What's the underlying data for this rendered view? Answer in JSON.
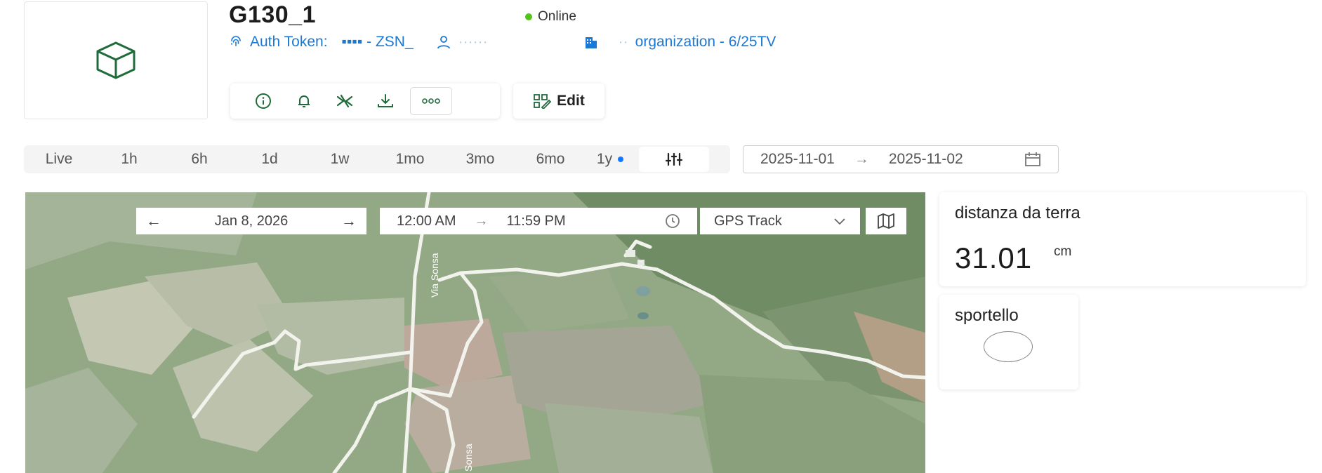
{
  "device": {
    "name": "G130_1",
    "status": "Online",
    "auth_token_label": "Auth Token:",
    "auth_token_value": "▪▪▪▪ - ZSN_",
    "user_value": "······",
    "org_prefix": "··",
    "org_value": "organization - 6/25TV",
    "thumbnail_icon": "cube-icon"
  },
  "colors": {
    "accent": "#1677ff",
    "online": "#52c41a",
    "brand_green": "#1f6b3a",
    "link": "#1b78d4"
  },
  "toolbar": {
    "icons": [
      "info-icon",
      "bell-icon",
      "settings-icon",
      "download-icon",
      "more-icon"
    ],
    "edit_label": "Edit"
  },
  "time_range": {
    "tabs": [
      "Live",
      "1h",
      "6h",
      "1d",
      "1w",
      "1mo",
      "3mo",
      "6mo",
      "1y"
    ],
    "selected": "1y",
    "start_date": "2025-11-01",
    "end_date": "2025-11-02"
  },
  "map": {
    "date": "Jan 8, 2026",
    "start_time": "12:00 AM",
    "end_time": "11:59 PM",
    "layer": "GPS Track",
    "road_labels": [
      "Via Sonsa",
      "Sonsa"
    ]
  },
  "widgets": {
    "distance": {
      "label": "distanza da terra",
      "value": "31.01",
      "unit": "cm"
    },
    "door": {
      "label": "sportello"
    }
  }
}
